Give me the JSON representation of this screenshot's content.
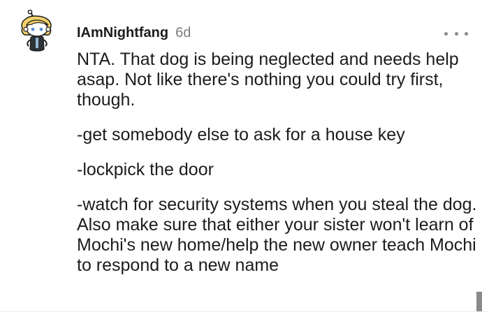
{
  "comment": {
    "username": "IAmNightfang",
    "timestamp": "6d",
    "avatar_icon": "snoo-avatar-icon",
    "more_icon": "more-options-icon",
    "paragraphs": [
      "NTA. That dog is being neglected and needs help asap. Not like there's nothing you could try first, though.",
      "-get somebody else to ask for a house key",
      "-lockpick the door",
      "-watch for security systems when you steal the dog. Also make sure that either your sister won't learn of Mochi's new home/help the new owner teach Mochi to respond to a new name"
    ],
    "colors": {
      "text": "#1c1c1c",
      "meta": "#7c7c7c",
      "icon": "#878a8c"
    }
  }
}
